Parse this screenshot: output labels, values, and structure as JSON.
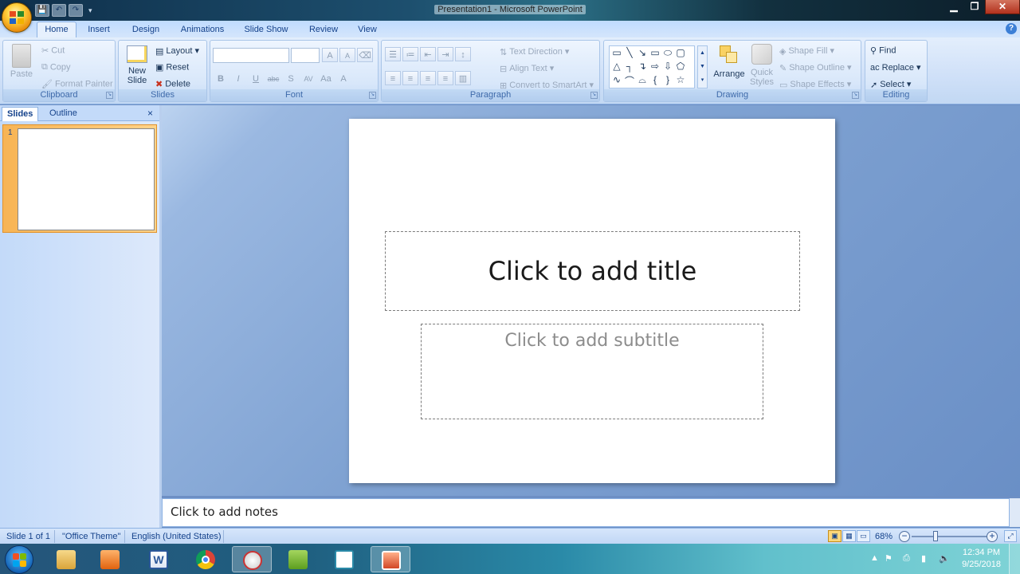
{
  "window": {
    "title": "Presentation1 - Microsoft PowerPoint"
  },
  "qat": {
    "save": "💾",
    "undo": "↶",
    "redo": "↷",
    "customize": "▾"
  },
  "tabs": [
    "Home",
    "Insert",
    "Design",
    "Animations",
    "Slide Show",
    "Review",
    "View"
  ],
  "clipboard": {
    "paste": "Paste",
    "cut": "Cut",
    "copy": "Copy",
    "format_painter": "Format Painter",
    "label": "Clipboard"
  },
  "slides_group": {
    "new_slide_1": "New",
    "new_slide_2": "Slide",
    "layout": "Layout",
    "reset": "Reset",
    "delete": "Delete",
    "label": "Slides"
  },
  "font_group": {
    "label": "Font",
    "bold": "B",
    "italic": "I",
    "underline": "U",
    "strike": "abc",
    "shadow": "S",
    "spacing": "AV",
    "case": "Aa",
    "color": "A",
    "grow": "A",
    "shrink": "A"
  },
  "paragraph_group": {
    "label": "Paragraph",
    "text_direction": "Text Direction",
    "align_text": "Align Text",
    "convert_smartart": "Convert to SmartArt"
  },
  "drawing_group": {
    "label": "Drawing",
    "arrange": "Arrange",
    "quick_styles_1": "Quick",
    "quick_styles_2": "Styles",
    "shape_fill": "Shape Fill",
    "shape_outline": "Shape Outline",
    "shape_effects": "Shape Effects"
  },
  "editing_group": {
    "label": "Editing",
    "find": "Find",
    "replace": "Replace",
    "select": "Select"
  },
  "left_pane": {
    "tab_slides": "Slides",
    "tab_outline": "Outline",
    "close": "×",
    "thumb_number": "1"
  },
  "slide": {
    "title_placeholder": "Click to add title",
    "subtitle_placeholder": "Click to add subtitle"
  },
  "notes": {
    "placeholder": "Click to add notes"
  },
  "statusbar": {
    "slide_info": "Slide 1 of 1",
    "theme": "\"Office Theme\"",
    "language": "English (United States)",
    "zoom": "68%"
  },
  "taskbar": {
    "time": "12:34 PM",
    "date": "9/25/2018"
  }
}
